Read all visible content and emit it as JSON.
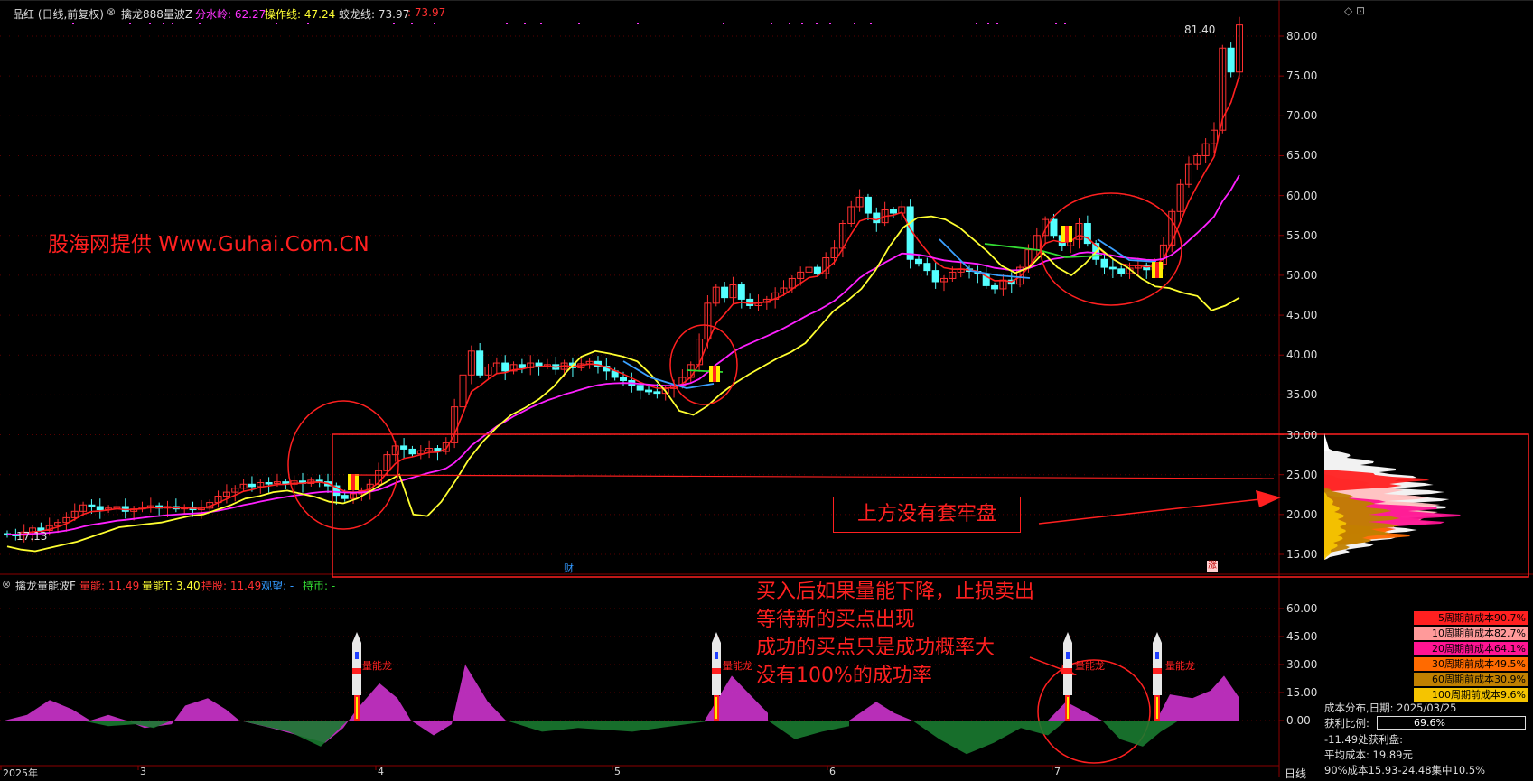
{
  "header": {
    "stock_label": "一品红 (日线,前复权)",
    "indicator_name": "擒龙888量波Z",
    "fenshui_label": "分水岭: 62.27",
    "caozuo_label": "操作线: 47.24",
    "jiaolong_label": "蛟龙线: 73.97",
    "jiaolong_extra": ": 73.97"
  },
  "sub_header": {
    "indicator_name": "擒龙量能波F",
    "liangneng_label": "量能: 11.49",
    "liangnengT_label": "量能T: 3.40",
    "chigu_label": "持股: 11.49",
    "guanwang_label": "观望: -",
    "chibi_label": "持币: -"
  },
  "price_axis": [
    "80.00",
    "75.00",
    "70.00",
    "65.00",
    "60.00",
    "55.00",
    "50.00",
    "45.00",
    "40.00",
    "35.00",
    "30.00",
    "25.00",
    "20.00",
    "15.00"
  ],
  "sub_axis": [
    "60.00",
    "45.00",
    "30.00",
    "15.00",
    "0.00"
  ],
  "x_axis": [
    "2025年",
    "3",
    "4",
    "5",
    "6",
    "7"
  ],
  "period_label": "日线",
  "labels": {
    "high_price": "81.40",
    "low_price": "17.13",
    "watermark": "股海网提供 Www.Guhai.Com.CN",
    "no_trapped": "上方没有套牢盘",
    "note_line1": "买入后如果量能下降，止损卖出",
    "note_line2": "等待新的买点出现",
    "note_line3": "成功的买点只是成功概率大",
    "note_line4": "没有100%的成功率",
    "cai_marker": "财",
    "zhang_marker": "涨",
    "rocket_label": "量能龙"
  },
  "cost_legend": [
    {
      "label": "5周期前成本90.7%",
      "color": "#ff2020"
    },
    {
      "label": "10周期前成本82.7%",
      "color": "#ff9a9a"
    },
    {
      "label": "20周期前成本64.1%",
      "color": "#ff1493"
    },
    {
      "label": "30周期前成本49.5%",
      "color": "#ff6a00"
    },
    {
      "label": "60周期前成本30.9%",
      "color": "#c08000"
    },
    {
      "label": "100周期前成本9.6%",
      "color": "#f5c400"
    }
  ],
  "cost_stats": {
    "date_line": "成本分布,日期: 2025/03/25",
    "profit_label": "获利比例:",
    "profit_value": "69.6%",
    "profit_ratio": 0.696,
    "line3": "-11.49处获利盘:",
    "line4": "平均成本: 19.89元",
    "line5": "90%成本15.93-24.48集中10.5%"
  },
  "colors": {
    "up": "#ff3030",
    "down": "#54ffff",
    "ma_fast": "#ff2020",
    "ma_mid": "#ff20ff",
    "ma_slow": "#ffff30",
    "annotation": "#ff2020",
    "grid": "#5a0000"
  }
}
